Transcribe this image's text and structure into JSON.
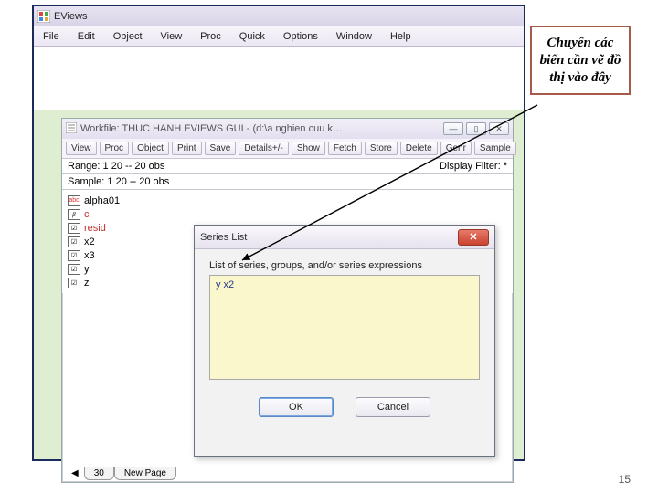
{
  "app": {
    "title": "EViews"
  },
  "menu": [
    "File",
    "Edit",
    "Object",
    "View",
    "Proc",
    "Quick",
    "Options",
    "Window",
    "Help"
  ],
  "workfile": {
    "title": "Workfile: THUC HANH EVIEWS GUI - (d:\\a nghien cuu k…",
    "toolbar": [
      "View",
      "Proc",
      "Object",
      "Print",
      "Save",
      "Details+/-",
      "Show",
      "Fetch",
      "Store",
      "Delete",
      "Genr",
      "Sample"
    ],
    "range": "Range: 1 20   --  20 obs",
    "sample": "Sample: 1 20   --  20 obs",
    "filter": "Display Filter: *",
    "vars": [
      {
        "icon": "abc",
        "label": "alpha01",
        "red": false
      },
      {
        "icon": "β",
        "label": "c",
        "red": true
      },
      {
        "icon": "✓",
        "label": "resid",
        "red": true
      },
      {
        "icon": "✓",
        "label": "x2",
        "red": false
      },
      {
        "icon": "✓",
        "label": "x3",
        "red": false
      },
      {
        "icon": "✓",
        "label": "y",
        "red": false
      },
      {
        "icon": "✓",
        "label": "z",
        "red": false
      }
    ],
    "tabs": [
      "30",
      "New Page"
    ]
  },
  "dialog": {
    "title": "Series List",
    "label": "List of series, groups, and/or series expressions",
    "value": "y x2",
    "ok": "OK",
    "cancel": "Cancel"
  },
  "callout": "Chuyển các biến cần vẽ đồ thị vào đây",
  "pagenum": "15"
}
